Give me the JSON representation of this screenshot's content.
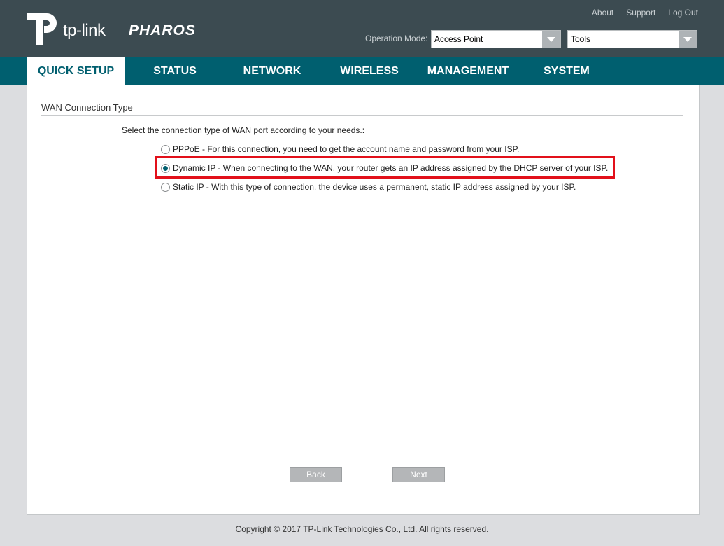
{
  "header": {
    "brand": "tp-link",
    "product": "PHAROS",
    "links": [
      "About",
      "Support",
      "Log Out"
    ],
    "operation_mode_label": "Operation Mode:",
    "operation_mode_value": "Access Point",
    "tools_value": "Tools"
  },
  "nav": {
    "tabs": [
      "QUICK SETUP",
      "STATUS",
      "NETWORK",
      "WIRELESS",
      "MANAGEMENT",
      "SYSTEM"
    ],
    "active_tab": "QUICK SETUP"
  },
  "main": {
    "section_title": "WAN Connection Type",
    "instruction": "Select the connection type of WAN port according to your needs.:",
    "options": [
      {
        "label": "PPPoE - For this connection, you need to get the account name and password from your ISP.",
        "checked": false
      },
      {
        "label": "Dynamic IP - When connecting to the WAN, your router gets an IP address assigned by the DHCP server of your ISP.",
        "checked": true
      },
      {
        "label": "Static IP - With this type of connection, the device uses a permanent, static IP address assigned by your ISP.",
        "checked": false
      }
    ],
    "back_label": "Back",
    "next_label": "Next"
  },
  "footer": {
    "copyright": "Copyright © 2017 TP-Link Technologies Co., Ltd. All rights reserved."
  },
  "colors": {
    "header_bg": "#3c4b51",
    "nav_bg": "#005f6f",
    "highlight": "#e2101a"
  },
  "icons": {
    "logo": "tp-link-logo-icon",
    "dropdown": "chevron-down-icon"
  }
}
